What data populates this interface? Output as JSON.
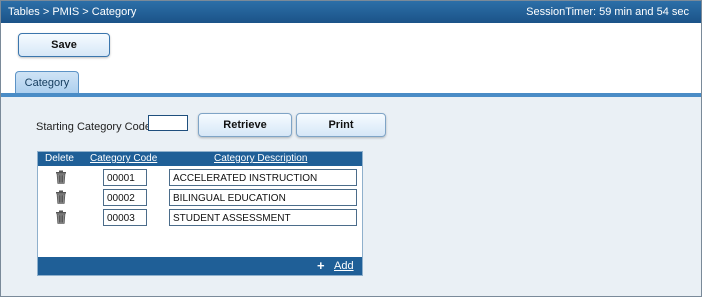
{
  "header": {
    "breadcrumb": "Tables > PMIS > Category",
    "session_timer": "SessionTimer: 59 min and 54 sec"
  },
  "toolbar": {
    "save_label": "Save"
  },
  "tabs": [
    {
      "label": "Category"
    }
  ],
  "form": {
    "starting_code_label": "Starting Category Code:",
    "starting_code_value": "",
    "retrieve_label": "Retrieve",
    "print_label": "Print"
  },
  "grid": {
    "columns": [
      "Delete",
      "Category Code",
      "Category Description"
    ],
    "rows": [
      {
        "code": "00001",
        "description": "ACCELERATED INSTRUCTION"
      },
      {
        "code": "00002",
        "description": "BILINGUAL EDUCATION"
      },
      {
        "code": "00003",
        "description": "STUDENT ASSESSMENT"
      }
    ],
    "add_label": "Add",
    "add_icon": "plus-icon",
    "delete_icon": "trash-icon"
  },
  "colors": {
    "header_bar": "#1b5388",
    "grid_header": "#1f5f97",
    "panel_background": "#eaf0f5",
    "button_gradient_top": "#f6fbff",
    "button_gradient_bottom": "#d6e7f7"
  }
}
